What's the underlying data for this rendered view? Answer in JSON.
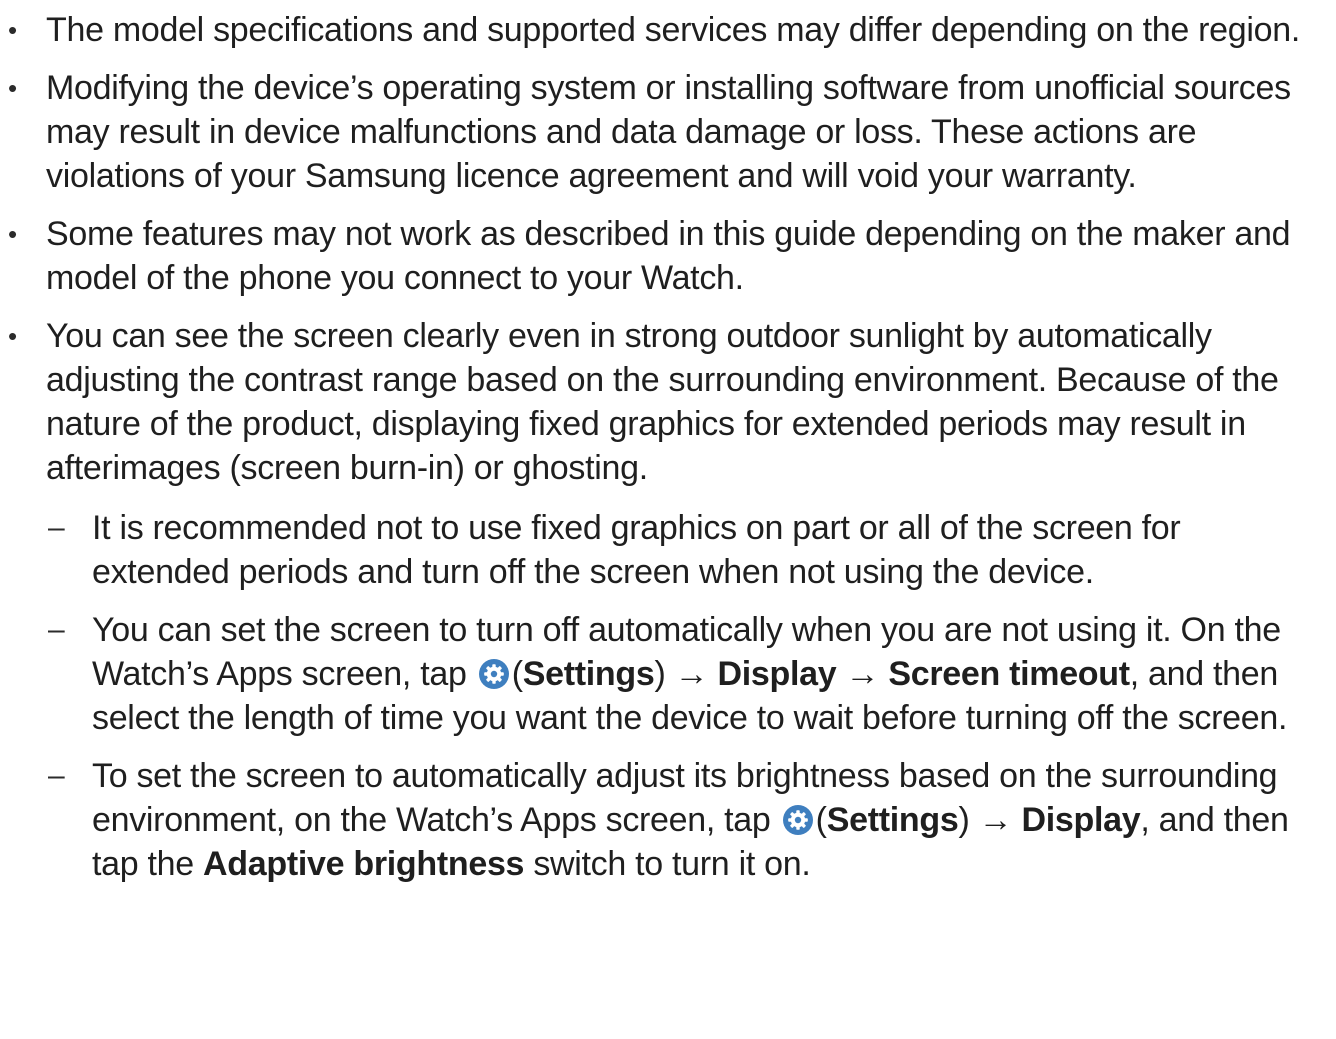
{
  "bullets": [
    {
      "marker": "•",
      "text": "The model specifications and supported services may differ depending on the region."
    },
    {
      "marker": "•",
      "text": "Modifying the device’s operating system or installing software from unofficial sources may result in device malfunctions and data damage or loss. These actions are violations of your Samsung licence agreement and will void your warranty."
    },
    {
      "marker": "•",
      "text": "Some features may not work as described in this guide depending on the maker and model of the phone you connect to your Watch."
    },
    {
      "marker": "•",
      "text": "You can see the screen clearly even in strong outdoor sunlight by automatically adjusting the contrast range based on the surrounding environment. Because of the nature of the product, displaying fixed graphics for extended periods may result in afterimages (screen burn-in) or ghosting."
    }
  ],
  "sub_bullets": {
    "marker": "–",
    "item1": "It is recommended not to use fixed graphics on part or all of the screen for extended periods and turn off the screen when not using the device.",
    "item2": {
      "part1": "You can set the screen to turn off automatically when you are not using it. On the Watch’s Apps screen, tap ",
      "paren_open": "(",
      "settings": "Settings",
      "paren_close": ")",
      "arrow1": " → ",
      "display": "Display",
      "arrow2": " → ",
      "screen_timeout": "Screen timeout",
      "part2": ", and then select the length of time you want the device to wait before turning off the screen."
    },
    "item3": {
      "part1": "To set the screen to automatically adjust its brightness based on the surrounding environment, on the Watch’s Apps screen, tap ",
      "paren_open": "(",
      "settings": "Settings",
      "paren_close": ")",
      "arrow1": " → ",
      "display": "Display",
      "part2": ", and then tap the ",
      "adaptive_brightness": "Adaptive brightness",
      "part3": " switch to turn it on."
    }
  },
  "icon": {
    "name": "settings-gear-icon",
    "color": "#3f7fbf"
  }
}
